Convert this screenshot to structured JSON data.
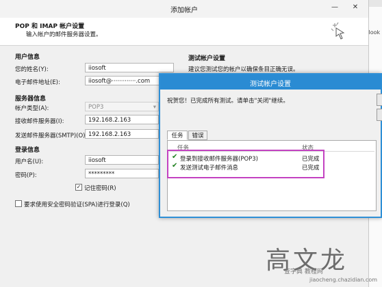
{
  "main_dialog": {
    "title": "添加帐户",
    "controls": {
      "minimize": "—",
      "close": "✕"
    },
    "header": {
      "title": "POP 和 IMAP 帐户设置",
      "subtitle": "输入帐户的邮件服务器设置。"
    },
    "user_info": {
      "heading": "用户信息",
      "name_label": "您的姓名(Y):",
      "name_value": "iiosoft",
      "email_label": "电子邮件地址(E):",
      "email_value": "iiosoft@·············.com"
    },
    "server_info": {
      "heading": "服务器信息",
      "account_type_label": "帐户类型(A):",
      "account_type_value": "POP3",
      "incoming_label": "接收邮件服务器(I):",
      "incoming_value": "192.168.2.163",
      "outgoing_label": "发送邮件服务器(SMTP)(O):",
      "outgoing_value": "192.168.2.163"
    },
    "login_info": {
      "heading": "登录信息",
      "username_label": "用户名(U):",
      "username_value": "iiosoft",
      "password_label": "密码(P):",
      "password_value": "*********",
      "remember_label": "记住密码(R)",
      "spa_label": "要求使用安全密码验证(SPA)进行登录(Q)"
    },
    "test_settings": {
      "heading": "测试帐户设置",
      "desc": "建议您测试您的帐户以确保条目正确无误。"
    }
  },
  "background_window": {
    "title_fragment": "Outlook"
  },
  "test_dialog": {
    "title": "测试帐户设置",
    "message": "祝贺您！已完成所有测试。请单击\"关闭\"继续。",
    "tabs": [
      "任务",
      "错误"
    ],
    "columns": {
      "task": "任务",
      "status": "状态"
    },
    "tasks": [
      {
        "name": "登录到接收邮件服务器(POP3)",
        "status": "已完成"
      },
      {
        "name": "发送测试电子邮件消息",
        "status": "已完成"
      }
    ]
  },
  "watermark": {
    "text": "高文龙",
    "sub": "查字典 教程网",
    "url": "jiaocheng.chazidian.com"
  },
  "colors": {
    "accent": "#2a8bd3",
    "highlight": "#c341c1",
    "check": "#1c7f1c"
  }
}
